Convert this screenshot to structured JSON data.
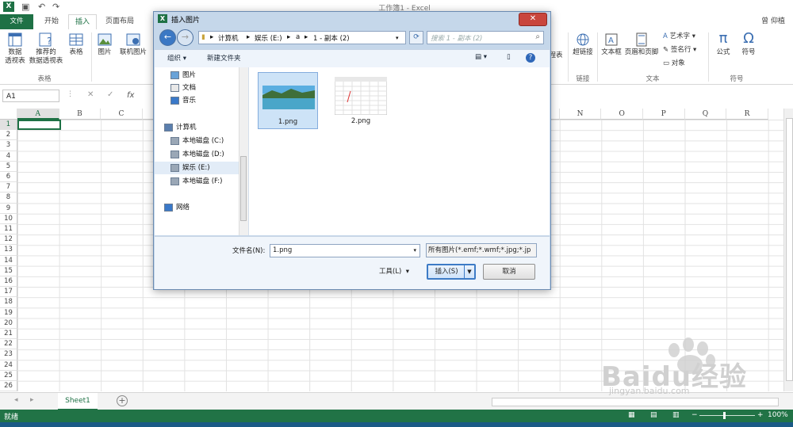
{
  "app": {
    "doc_title": "工作簿1 - Excel",
    "user_name": "曾 仰植",
    "file_tab": "文件",
    "tabs": [
      "开始",
      "插入",
      "页面布局"
    ],
    "active_tab": "插入"
  },
  "ribbon": {
    "left": [
      {
        "label_line1": "数据",
        "label_line2": "透视表"
      },
      {
        "label_line1": "推荐的",
        "label_line2": "数据透视表"
      },
      {
        "label_line1": "表格",
        "label_line2": ""
      },
      {
        "label_line1": "图片",
        "label_line2": ""
      },
      {
        "label_line1": "联机图片",
        "label_line2": ""
      }
    ],
    "left_group": "表格",
    "right": {
      "timeline_tail": "程表",
      "hyperlink": "超链接",
      "textbox": "文本框",
      "header_footer": "页眉和页脚",
      "wordart": "艺术字",
      "signature": "签名行",
      "object": "对象",
      "formula": "公式",
      "symbol": "符号"
    },
    "right_groups": {
      "links": "链接",
      "text": "文本",
      "symbols": "符号"
    }
  },
  "formula_bar": {
    "name_box": "A1",
    "fx": "fx"
  },
  "grid": {
    "columns": [
      "A",
      "B",
      "C",
      "D",
      "E",
      "F",
      "G",
      "H",
      "I",
      "J",
      "K",
      "L",
      "M",
      "N",
      "O",
      "P",
      "Q",
      "R"
    ],
    "rows": [
      "1",
      "2",
      "3",
      "4",
      "5",
      "6",
      "7",
      "8",
      "9",
      "10",
      "11",
      "12",
      "13",
      "14",
      "15",
      "16",
      "17",
      "18",
      "19",
      "20",
      "21",
      "22",
      "23",
      "24",
      "25",
      "26"
    ]
  },
  "sheet_tabs": {
    "active": "Sheet1"
  },
  "status": {
    "ready": "就绪",
    "zoom": "100%"
  },
  "dialog": {
    "title": "插入图片",
    "breadcrumbs": [
      "计算机",
      "娱乐 (E:)",
      "a",
      "1 - 副本 (2)"
    ],
    "search_placeholder": "搜索 1 - 副本 (2)",
    "toolbar": {
      "organize": "组织 ▾",
      "new_folder": "新建文件夹"
    },
    "nav": [
      {
        "label": "图片",
        "icon": "pictures-icon"
      },
      {
        "label": "文档",
        "icon": "documents-icon"
      },
      {
        "label": "音乐",
        "icon": "music-icon"
      },
      {
        "label": "计算机",
        "icon": "computer-icon"
      },
      {
        "label": "本地磁盘 (C:)",
        "icon": "drive-icon"
      },
      {
        "label": "本地磁盘 (D:)",
        "icon": "drive-icon"
      },
      {
        "label": "娱乐 (E:)",
        "icon": "drive-icon"
      },
      {
        "label": "本地磁盘 (F:)",
        "icon": "drive-icon"
      },
      {
        "label": "网络",
        "icon": "network-icon"
      }
    ],
    "selected_nav": "娱乐 (E:)",
    "files": [
      {
        "name": "1.png",
        "selected": true
      },
      {
        "name": "2.png",
        "selected": false
      }
    ],
    "filename_label": "文件名(N):",
    "filename_value": "1.png",
    "filetype_value": "所有图片(*.emf;*.wmf;*.jpg;*.jp",
    "tools_label": "工具(L)",
    "insert_label": "插入(S)",
    "cancel_label": "取消"
  },
  "watermark": {
    "text": "Baidu经验",
    "sub": "jingyan.baidu.com"
  }
}
